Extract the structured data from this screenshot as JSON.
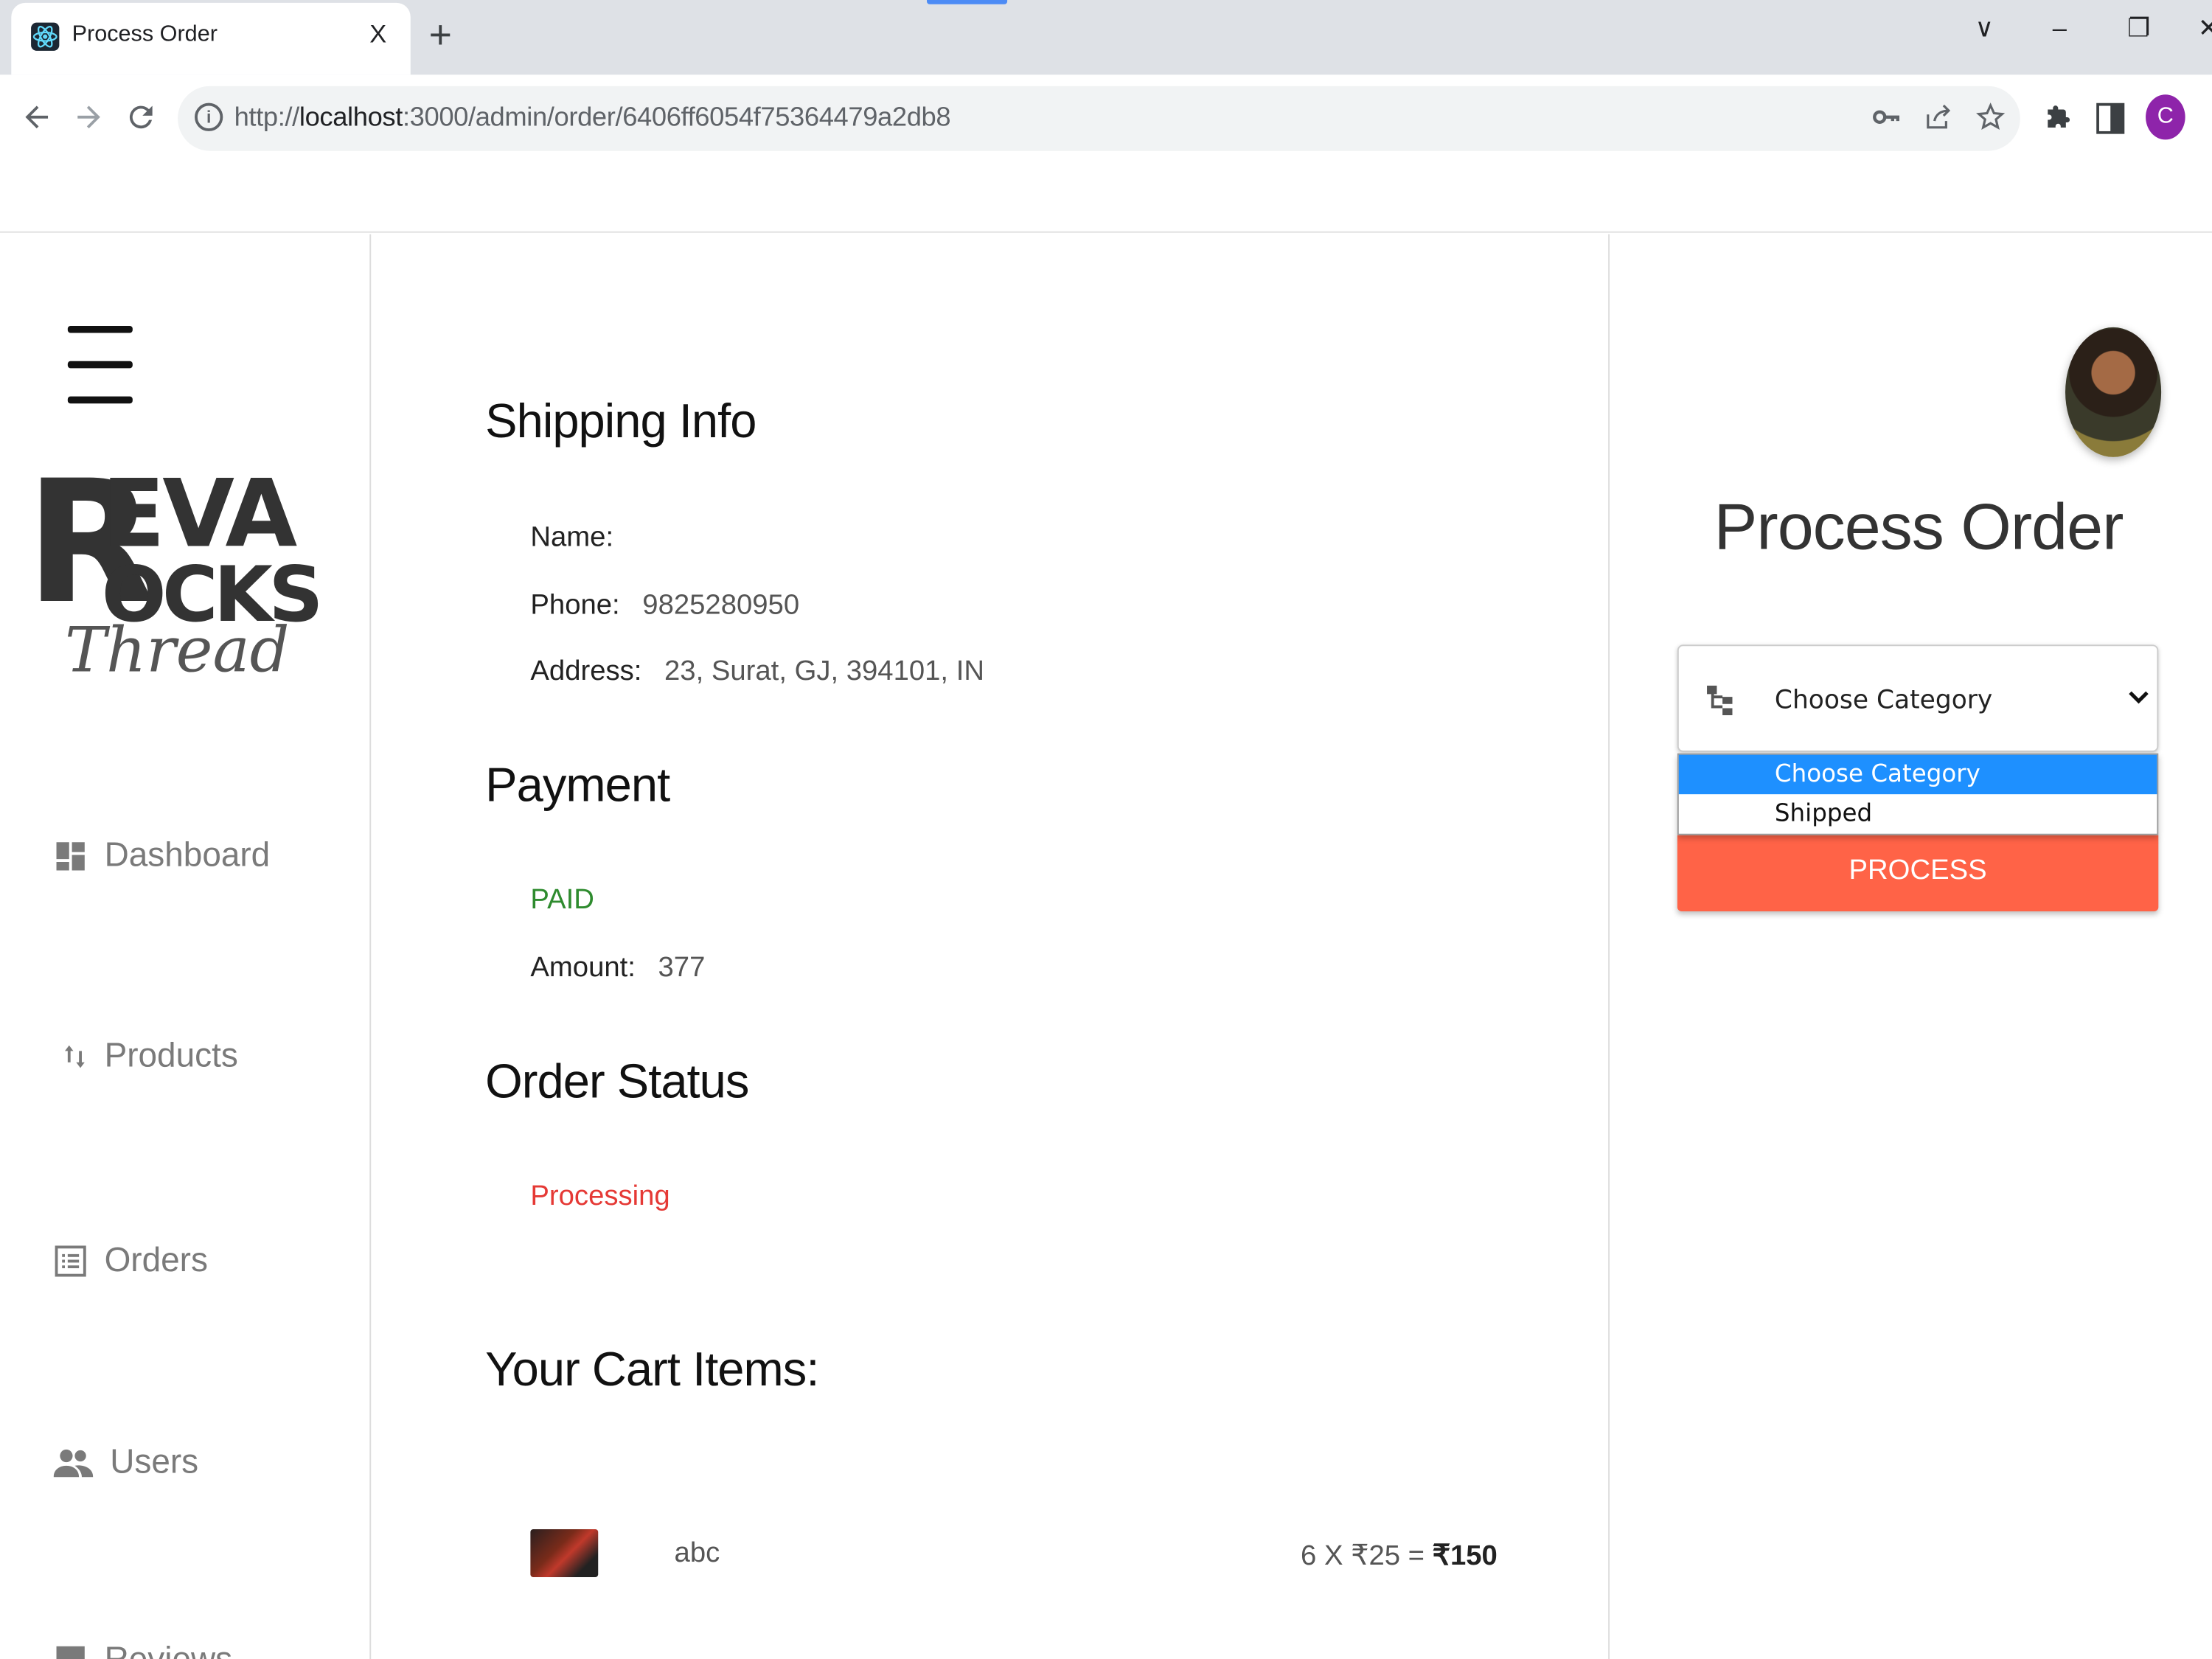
{
  "browser": {
    "tab_title": "Process Order",
    "tab_close": "X",
    "new_tab": "+",
    "url_scheme": "http://",
    "url_host": "localhost",
    "url_rest": ":3000/admin/order/6406ff6054f75364479a2db8",
    "profile_initial": "C",
    "window_controls": [
      "∨",
      "–",
      "❐",
      "✕"
    ]
  },
  "sidebar": {
    "logo": {
      "line1": "EVA",
      "line2": "OCKS",
      "initial": "R",
      "script": "Thread"
    },
    "items": [
      {
        "label": "Dashboard",
        "icon": "dashboard-icon"
      },
      {
        "label": "Products",
        "icon": "import-export-icon"
      },
      {
        "label": "Orders",
        "icon": "list-alt-icon"
      },
      {
        "label": "Users",
        "icon": "people-icon"
      },
      {
        "label": "Reviews",
        "icon": "rate-review-icon"
      }
    ]
  },
  "shipping": {
    "heading": "Shipping Info",
    "name_label": "Name:",
    "name_value": "",
    "phone_label": "Phone:",
    "phone_value": "9825280950",
    "address_label": "Address:",
    "address_value": "23, Surat, GJ, 394101, IN"
  },
  "payment": {
    "heading": "Payment",
    "status": "PAID",
    "amount_label": "Amount:",
    "amount_value": "377"
  },
  "order_status": {
    "heading": "Order Status",
    "value": "Processing"
  },
  "cart": {
    "heading": "Your Cart Items:",
    "items": [
      {
        "name": "abc",
        "calc_prefix": "6 X ₹25 = ",
        "total": "₹150"
      }
    ]
  },
  "process_panel": {
    "title": "Process Order",
    "select_value": "Choose Category",
    "options": [
      "Choose Category",
      "Shipped"
    ],
    "button_label": "PROCESS"
  },
  "colors": {
    "accent_button": "#ff6347",
    "paid": "#2e8b2e",
    "processing": "#e53935",
    "dropdown_selected": "#1e90ff"
  }
}
